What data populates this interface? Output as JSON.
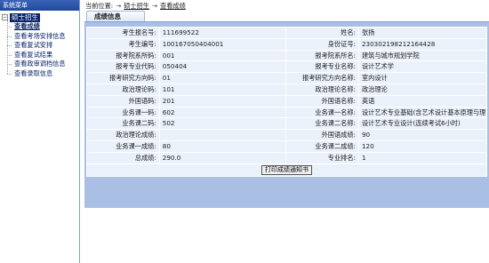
{
  "sidebar": {
    "title": "系统菜单",
    "root": {
      "toggle": "−",
      "label": "硕士招生"
    },
    "items": [
      {
        "label": "查看成绩",
        "selected": true
      },
      {
        "label": "查看考场安排信息",
        "selected": false
      },
      {
        "label": "查看复试安排",
        "selected": false
      },
      {
        "label": "查看复试结果",
        "selected": false
      },
      {
        "label": "查看政审调档信息",
        "selected": false
      },
      {
        "label": "查看录取信息",
        "selected": false
      }
    ]
  },
  "breadcrumb": {
    "prefix": "当前位置:",
    "arrow1": "→",
    "level1": "硕士招生",
    "arrow2": "→",
    "level2": "查看成绩"
  },
  "panel": {
    "title": "成绩信息"
  },
  "rows": [
    [
      {
        "label": "考生报名号:",
        "value": "111699522"
      },
      {
        "label": "姓名:",
        "value": "张扬"
      }
    ],
    [
      {
        "label": "考生编号:",
        "value": "100167050404001"
      },
      {
        "label": "身份证号:",
        "value": "230302198212164428"
      }
    ],
    [
      {
        "label": "报考院系所码:",
        "value": "001"
      },
      {
        "label": "报考院系所名:",
        "value": "建筑与城市规划学院"
      }
    ],
    [
      {
        "label": "报考专业代码:",
        "value": "050404"
      },
      {
        "label": "报考专业名称:",
        "value": "设计艺术学"
      }
    ],
    [
      {
        "label": "报考研究方向码:",
        "value": "01"
      },
      {
        "label": "报考研究方向名称:",
        "value": "室内设计"
      }
    ],
    [
      {
        "label": "政治理论码:",
        "value": "101"
      },
      {
        "label": "政治理论名称:",
        "value": "政治理论"
      }
    ],
    [
      {
        "label": "外国语码:",
        "value": "201"
      },
      {
        "label": "外国语名称:",
        "value": "英语"
      }
    ],
    [
      {
        "label": "业务课一码:",
        "value": "602"
      },
      {
        "label": "业务课一名称:",
        "value": "设计艺术专业基础(含艺术设计基本原理与理"
      }
    ],
    [
      {
        "label": "业务课二码:",
        "value": "502"
      },
      {
        "label": "业务课二名称:",
        "value": "设计艺术专业设计(连续考试6小时)"
      }
    ],
    [
      {
        "label": "政治理论成绩:",
        "value": ""
      },
      {
        "label": "外国语成绩:",
        "value": "90"
      }
    ],
    [
      {
        "label": "业务课一成绩:",
        "value": "80"
      },
      {
        "label": "业务课二成绩:",
        "value": "120"
      }
    ],
    [
      {
        "label": "总成绩:",
        "value": "290.0"
      },
      {
        "label": "专业排名:",
        "value": "1"
      }
    ]
  ],
  "print_button": "打印成绩通知书"
}
